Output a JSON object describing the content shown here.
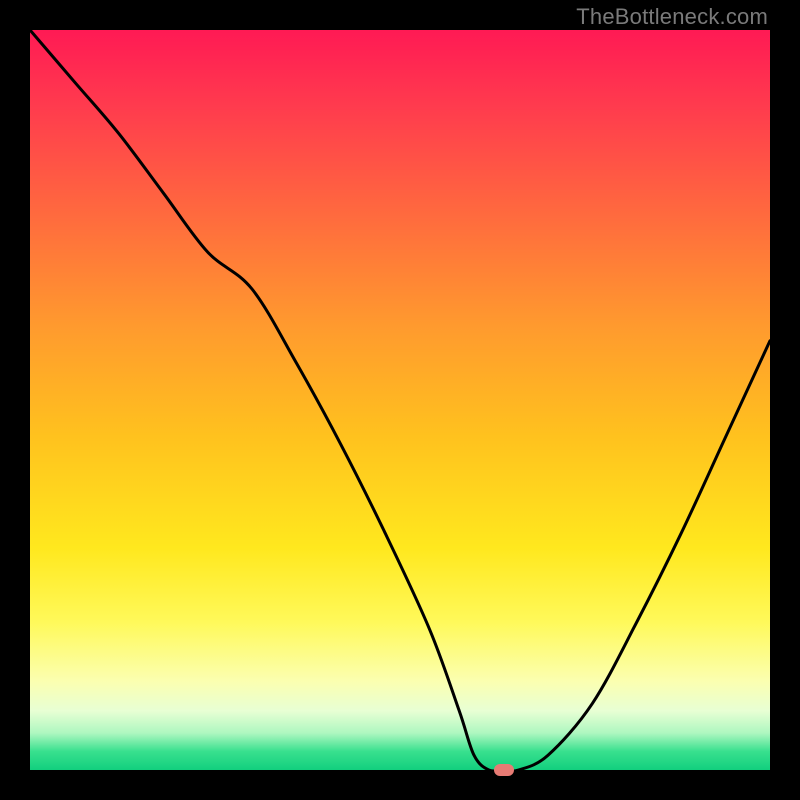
{
  "watermark": "TheBottleneck.com",
  "colors": {
    "frame": "#000000",
    "curve": "#000000",
    "marker": "#e77b74"
  },
  "chart_data": {
    "type": "line",
    "title": "",
    "xlabel": "",
    "ylabel": "",
    "xlim": [
      0,
      100
    ],
    "ylim": [
      0,
      100
    ],
    "grid": false,
    "legend": false,
    "series": [
      {
        "name": "bottleneck-curve",
        "x": [
          0,
          6,
          12,
          18,
          24,
          30,
          36,
          42,
          48,
          54,
          58,
          60,
          62,
          64,
          66,
          70,
          76,
          82,
          88,
          94,
          100
        ],
        "y": [
          100,
          93,
          86,
          78,
          70,
          65,
          55,
          44,
          32,
          19,
          8,
          2,
          0,
          0,
          0,
          2,
          9,
          20,
          32,
          45,
          58
        ]
      }
    ],
    "annotations": [
      {
        "name": "optimum-marker",
        "x": 64,
        "y": 0
      }
    ],
    "background_gradient": {
      "orientation": "vertical",
      "stops": [
        {
          "pos": 0.0,
          "color": "#ff1a54"
        },
        {
          "pos": 0.25,
          "color": "#ff6a3e"
        },
        {
          "pos": 0.55,
          "color": "#ffc21e"
        },
        {
          "pos": 0.8,
          "color": "#fff95a"
        },
        {
          "pos": 0.95,
          "color": "#aef7c0"
        },
        {
          "pos": 1.0,
          "color": "#12cf7e"
        }
      ]
    }
  }
}
